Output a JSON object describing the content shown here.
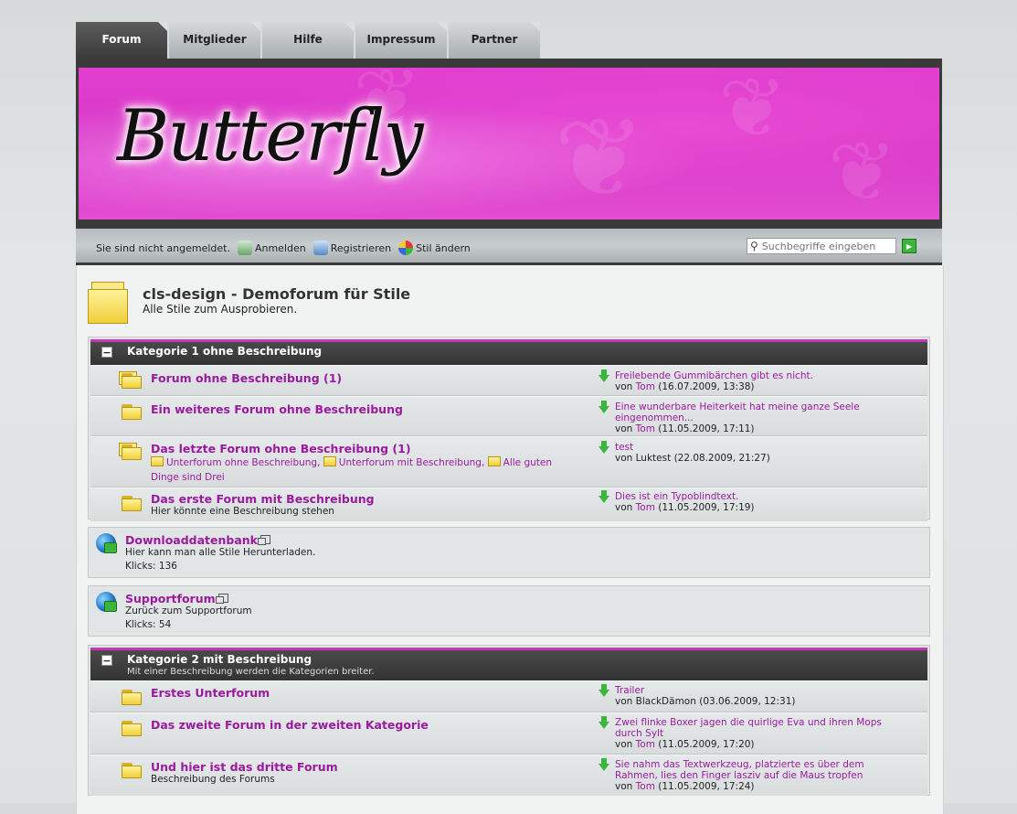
{
  "tabs": [
    "Forum",
    "Mitglieder",
    "Hilfe",
    "Impressum",
    "Partner"
  ],
  "logo": "Butterfly",
  "userbar": {
    "status": "Sie sind nicht angemeldet.",
    "login": "Anmelden",
    "register": "Registrieren",
    "style": "Stil ändern",
    "search_placeholder": "Suchbegriffe eingeben"
  },
  "page": {
    "title": "cls-design - Demoforum für Stile",
    "subtitle": "Alle Stile zum Ausprobieren."
  },
  "categories": [
    {
      "title": "Kategorie 1 ohne Beschreibung",
      "desc": "",
      "forums": [
        {
          "title": "Forum ohne Beschreibung (1)",
          "desc": "",
          "last_title": "Freilebende Gummibärchen gibt es nicht.",
          "last_by_prefix": "von",
          "last_user": "Tom",
          "last_date": "(16.07.2009, 13:38)"
        },
        {
          "title": "Ein weiteres Forum ohne Beschreibung",
          "desc": "",
          "last_title": "Eine wunderbare Heiterkeit hat meine ganze Seele eingenommen...",
          "last_by_prefix": "von",
          "last_user": "Tom",
          "last_date": "(11.05.2009, 17:11)"
        },
        {
          "title": "Das letzte Forum ohne Beschreibung (1)",
          "subforums": [
            "Unterforum ohne Beschreibung",
            "Unterforum mit Beschreibung",
            "Alle guten Dinge sind Drei"
          ],
          "last_title": "test",
          "last_by_prefix": "von",
          "last_user": "Luktest",
          "last_date": "(22.08.2009, 21:27)"
        },
        {
          "title": "Das erste Forum mit Beschreibung",
          "desc": "Hier könnte eine Beschreibung stehen",
          "last_title": "Dies ist ein Typoblindtext.",
          "last_by_prefix": "von",
          "last_user": "Tom",
          "last_date": "(11.05.2009, 17:19)"
        }
      ]
    },
    {
      "title": "Kategorie 2 mit Beschreibung",
      "desc": "Mit einer Beschreibung werden die Kategorien breiter.",
      "forums": [
        {
          "title": "Erstes Unterforum",
          "desc": "",
          "last_title": "Trailer",
          "last_by_prefix": "von",
          "last_user": "BlackDämon",
          "last_date": "(03.06.2009, 12:31)"
        },
        {
          "title": "Das zweite Forum in der zweiten Kategorie",
          "desc": "",
          "last_title": "Zwei flinke Boxer jagen die quirlige Eva und ihren Mops durch Sylt",
          "last_by_prefix": "von",
          "last_user": "Tom",
          "last_date": "(11.05.2009, 17:20)"
        },
        {
          "title": "Und hier ist das dritte Forum",
          "desc": "Beschreibung des Forums",
          "last_title": "Sie nahm das Textwerkzeug, platzierte es über dem Rahmen, lies den Finger lasziv auf die Maus tropfen",
          "last_by_prefix": "von",
          "last_user": "Tom",
          "last_date": "(11.05.2009, 17:24)"
        }
      ]
    }
  ],
  "links": [
    {
      "title": "Downloaddatenbank",
      "desc": "Hier kann man alle Stile Herunterladen.",
      "clicks": "Klicks: 136"
    },
    {
      "title": "Supportforum",
      "desc": "Zurück zum Supportforum",
      "clicks": "Klicks: 54"
    }
  ],
  "colors": {
    "accent": "#9b1aa0",
    "banner": "#e23fd0",
    "dark": "#3a3a3a"
  }
}
